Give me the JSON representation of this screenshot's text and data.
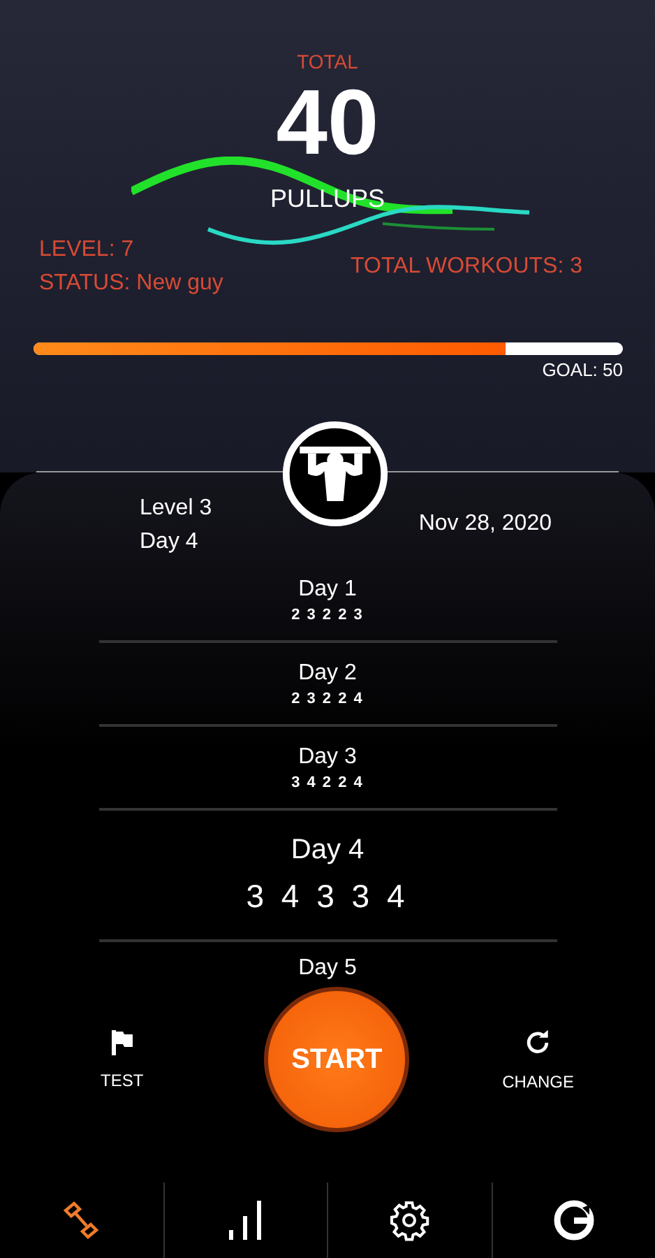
{
  "summary": {
    "total_label": "TOTAL",
    "total": "40",
    "unit": "PULLUPS",
    "level": "LEVEL: 7",
    "status": "STATUS: New guy",
    "workouts": "TOTAL WORKOUTS: 3"
  },
  "goal": {
    "level": 0.8,
    "label": "GOAL: 50"
  },
  "plan": {
    "level": "Level 3",
    "day": "Day 4",
    "date": "Nov 28, 2020"
  },
  "days": [
    {
      "title": "Day 1",
      "sets": "2 3 2 2 3",
      "selected": false
    },
    {
      "title": "Day 2",
      "sets": "2 3 2 2 4",
      "selected": false
    },
    {
      "title": "Day 3",
      "sets": "3 4 2 2 4",
      "selected": false
    },
    {
      "title": "Day 4",
      "sets": "3 4 3 3 4",
      "selected": true
    },
    {
      "title": "Day 5",
      "selected": false
    }
  ],
  "actions": {
    "test": "TEST",
    "start": "START",
    "change": "CHANGE"
  },
  "nav": [
    {
      "kind": "dumbbell",
      "selected": true
    },
    {
      "kind": "chart",
      "selected": false
    },
    {
      "kind": "gear",
      "selected": false
    },
    {
      "kind": "g",
      "selected": false
    }
  ]
}
